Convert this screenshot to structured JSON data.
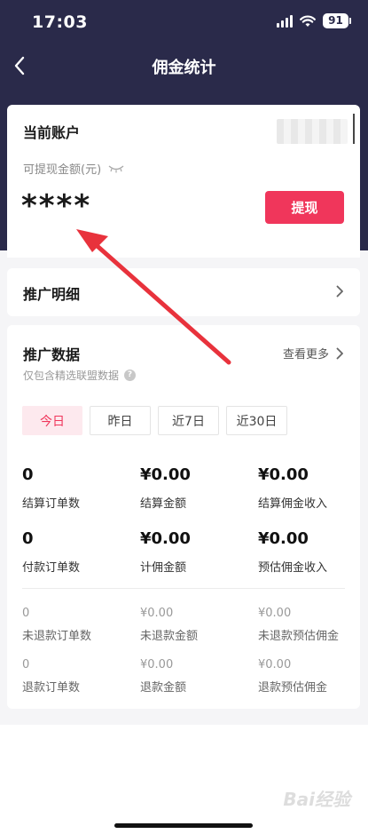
{
  "status_bar": {
    "time": "17:03",
    "battery": "91"
  },
  "nav": {
    "title": "佣金统计"
  },
  "account": {
    "label": "当前账户",
    "withdrawable_label": "可提现金额(元)",
    "masked_amount": "****",
    "withdraw_button": "提现"
  },
  "promo_detail": {
    "title": "推广明细"
  },
  "promo_data": {
    "title": "推广数据",
    "see_more": "查看更多",
    "note": "仅包含精选联盟数据",
    "tabs": [
      {
        "label": "今日",
        "active": true
      },
      {
        "label": "昨日",
        "active": false
      },
      {
        "label": "近7日",
        "active": false
      },
      {
        "label": "近30日",
        "active": false
      }
    ],
    "stats_main": [
      {
        "value": "0",
        "label": "结算订单数"
      },
      {
        "value": "¥0.00",
        "label": "结算金额"
      },
      {
        "value": "¥0.00",
        "label": "结算佣金收入"
      },
      {
        "value": "0",
        "label": "付款订单数"
      },
      {
        "value": "¥0.00",
        "label": "计佣金额"
      },
      {
        "value": "¥0.00",
        "label": "预估佣金收入"
      }
    ],
    "stats_secondary": [
      {
        "value": "0",
        "label": "未退款订单数"
      },
      {
        "value": "¥0.00",
        "label": "未退款金额"
      },
      {
        "value": "¥0.00",
        "label": "未退款预估佣金"
      },
      {
        "value": "0",
        "label": "退款订单数"
      },
      {
        "value": "¥0.00",
        "label": "退款金额"
      },
      {
        "value": "¥0.00",
        "label": "退款预估佣金"
      }
    ]
  },
  "watermark": "Bai经验",
  "colors": {
    "header_bg": "#2a2a4a",
    "accent": "#f0365b",
    "tab_active_bg": "#fde9ee"
  },
  "icons": [
    "back-icon",
    "signal-icon",
    "wifi-icon",
    "battery-icon",
    "eye-closed-icon",
    "chevron-right-icon",
    "help-icon"
  ]
}
